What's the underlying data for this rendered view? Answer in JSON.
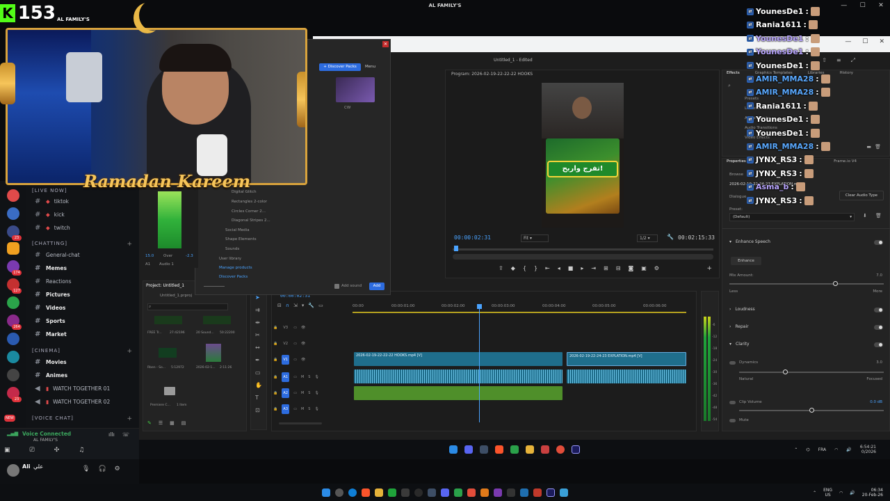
{
  "overlay": {
    "viewer_count": "153",
    "channel_name": "AL FAMILY'S",
    "banner_text": "Ramadan Kareem",
    "window_title": "AL FAMILY'S"
  },
  "discord": {
    "categories": [
      "[LIVE NOW]",
      "[CHATTING]",
      "[CINEMA]",
      "[VOICE CHAT]"
    ],
    "live_channels": [
      "tiktok",
      "kick",
      "twitch"
    ],
    "chat_channels": [
      "General-chat",
      "Memes",
      "Reactions",
      "Pictures",
      "Videos",
      "Sports",
      "Market"
    ],
    "cinema_channels": [
      "Movies",
      "Animes",
      "WATCH TOGETHER 01",
      "WATCH TOGETHER 02"
    ],
    "server_badges": [
      "23",
      "174",
      "127",
      "264",
      "23",
      "NEW"
    ],
    "voice_status": "Voice Connected",
    "voice_channel": "AL FAMILY'S",
    "username": "Ali",
    "username_arabic": "علي"
  },
  "premiere": {
    "title": "Untitled_1 - Edited",
    "program_label": "Program: 2026-02-19-22-22-22 HOOKS",
    "timecode_left": "00:00:02:31",
    "timecode_right": "00:02:15:33",
    "fit": "Fit",
    "ratio": "1/2",
    "project_tab": "Project: Untitled_1",
    "project_file": "Untitled_1.prproj",
    "timeline_timecode": "00:00:02:31",
    "ruler": [
      "00:00",
      "00:00:01:00",
      "00:00:02:00",
      "00:00:03:00",
      "00:00:04:00",
      "00:00:05:00",
      "00:00:06:00"
    ],
    "tracks": [
      "V3",
      "V2",
      "V1",
      "A1",
      "A2",
      "A3"
    ],
    "clip1": "2026-02-19-22-22-22 HOOKS.mp4 [V]",
    "clip2": "2026-02-19-22-24-23 EXPLATION.mp4 [V]",
    "meter_scale": [
      "-6",
      "-12",
      "-18",
      "-24",
      "-30",
      "-36",
      "-42",
      "-48",
      "-54",
      "dB"
    ],
    "bins": [
      {
        "name": "FREE Tr...",
        "sub": "27:42196"
      },
      {
        "name": "20 Sound...",
        "sub": "50:22200"
      },
      {
        "name": "Rben - So...",
        "sub": "5:12972"
      },
      {
        "name": "2026-02-1...",
        "sub": "2:11:26"
      },
      {
        "name": "Premiere C...",
        "sub": "1 Item"
      }
    ],
    "video_overlay_text": "تفرج واربح!",
    "audio_meter_values": [
      "15.0",
      "Over",
      "-2.3"
    ],
    "audio_meter_labels": [
      "A1",
      "Audio 1"
    ]
  },
  "packs": {
    "discover": "+ Discover Packs",
    "menu": "Menu",
    "thumb_label": "CW",
    "items": [
      "Digital Glitch",
      "Rectangles 2-color",
      "Circles Corner 2...",
      "Diagonal Stripes 2...",
      "Social Media",
      "Shape Elements",
      "Sounds",
      "User library",
      "Manage products",
      "Discover Packs"
    ],
    "add_sound": "Add sound",
    "add": "Add"
  },
  "effects_panel": {
    "tabs": [
      "Effects",
      "Graphics Templates",
      "Libraries",
      "History"
    ],
    "tree": [
      "Presets",
      "Lumetri Presets",
      "Audio Effects",
      "Audio Transitions",
      "Video Effects"
    ],
    "properties_tabs": [
      "Properties",
      "Color",
      "Frame.io V4"
    ],
    "browse": "Browse",
    "file_label": "2026-02-19-22-24-23 EXPLATION.mp4",
    "dialogue": "Dialogue",
    "clear_audio_type": "Clear Audio Type",
    "preset": "Preset:",
    "preset_value": "(Default)",
    "enhance_speech": "Enhance Speech",
    "enhance": "Enhance",
    "mix_amount": "Mix Amount:",
    "mix_value": "7.0",
    "less": "Less",
    "more": "More",
    "loudness": "Loudness",
    "repair": "Repair",
    "clarity": "Clarity",
    "dynamics": "Dynamics",
    "dyn_value": "3.0",
    "natural": "Natural",
    "focused": "Focused",
    "clip_volume": "Clip Volume",
    "clip_volume_value": "0.0 dB",
    "mute": "Mute"
  },
  "chat": [
    {
      "user": "YounesDe1",
      "color": "#ffffff"
    },
    {
      "user": "Rania1611",
      "color": "#ffffff"
    },
    {
      "user": "YounesDe1",
      "color": "#b9a6ff"
    },
    {
      "user": "YounesDe1",
      "color": "#b9a6ff"
    },
    {
      "user": "YounesDe1",
      "color": "#ffffff"
    },
    {
      "user": "AMIR_MMA28",
      "color": "#5aa9ff"
    },
    {
      "user": "AMIR_MMA28",
      "color": "#5aa9ff"
    },
    {
      "user": "Rania1611",
      "color": "#ffffff"
    },
    {
      "user": "YounesDe1",
      "color": "#ffffff"
    },
    {
      "user": "YounesDe1",
      "color": "#ffffff"
    },
    {
      "user": "AMIR_MMA28",
      "color": "#5aa9ff"
    },
    {
      "user": "JYNX_RS3",
      "color": "#ffffff"
    },
    {
      "user": "JYNX_RS3",
      "color": "#ffffff"
    },
    {
      "user": "Asma_b",
      "color": "#b9a6ff"
    },
    {
      "user": "JYNX_RS3",
      "color": "#ffffff"
    }
  ],
  "taskbar": {
    "lang": "ENG",
    "region": "US",
    "time": "06:34",
    "date": "20-Feb-26",
    "lang2": "FRA",
    "time2": "6:54:21",
    "date2": "0/2026"
  },
  "colors": {
    "accent_blue": "#2d8ceb",
    "clip_teal": "#1f6e8c",
    "clip_green": "#4f8f2a",
    "frame_gold": "#d9a33c",
    "kick_green": "#53fc18"
  }
}
